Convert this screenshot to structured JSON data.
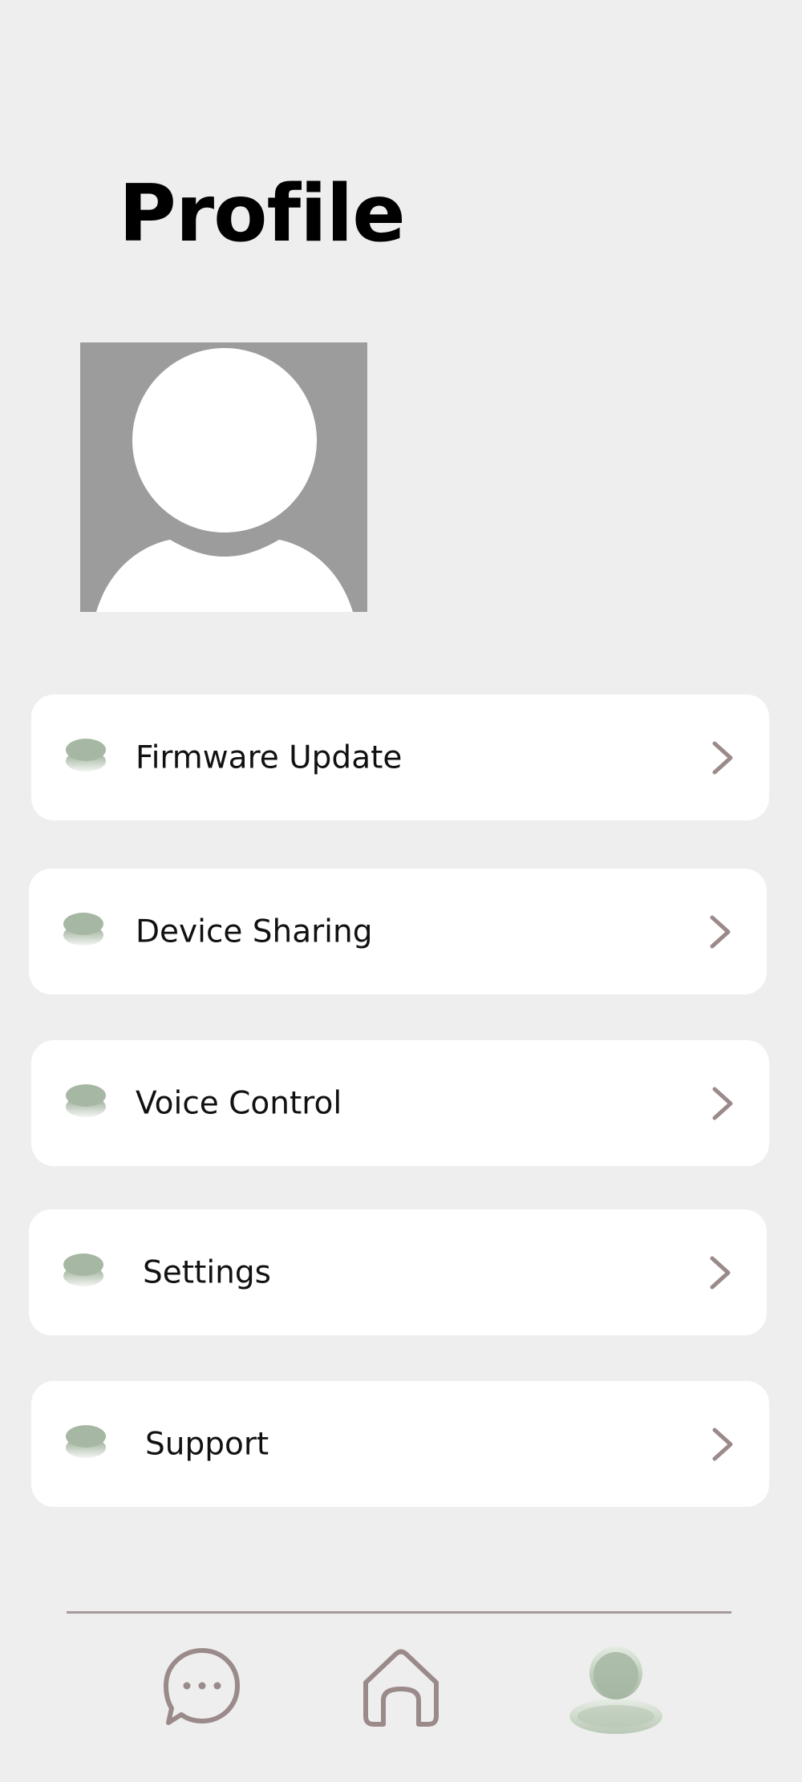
{
  "header": {
    "title": "Profile"
  },
  "menu": {
    "items": [
      {
        "label": "Firmware Update"
      },
      {
        "label": "Device Sharing"
      },
      {
        "label": "Voice Control"
      },
      {
        "label": "Settings"
      },
      {
        "label": "Support"
      }
    ]
  },
  "bottom_nav": {
    "items": [
      {
        "icon": "chat-bubble-icon",
        "active": false
      },
      {
        "icon": "home-icon",
        "active": false
      },
      {
        "icon": "profile-icon",
        "active": true
      }
    ]
  },
  "colors": {
    "background": "#eeeeee",
    "card": "#ffffff",
    "accent_green": "#a9bba6",
    "icon_gray": "#9b8a8a",
    "avatar_bg": "#9c9c9c"
  }
}
